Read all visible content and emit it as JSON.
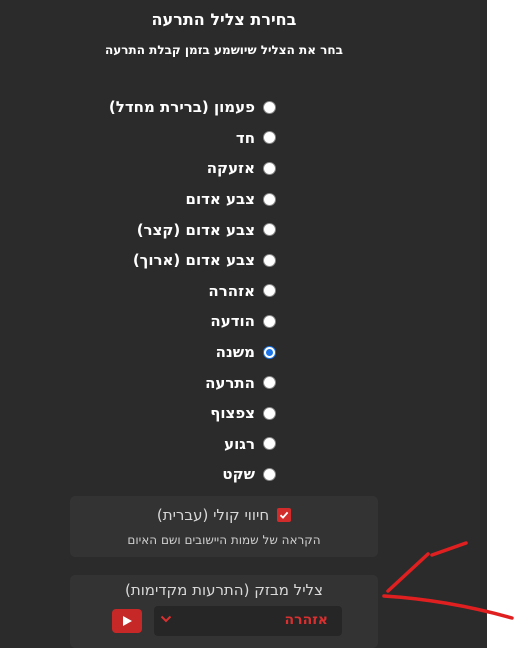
{
  "header": {
    "title": "בחירת צליל התרעה",
    "subtitle": "בחר את הצליל שיושמע בזמן קבלת התרעה"
  },
  "sound_options": [
    {
      "label": "פעמון (ברירת מחדל)",
      "selected": false
    },
    {
      "label": "חד",
      "selected": false
    },
    {
      "label": "אזעקה",
      "selected": false
    },
    {
      "label": "צבע אדום",
      "selected": false
    },
    {
      "label": "צבע אדום (קצר)",
      "selected": false
    },
    {
      "label": "צבע אדום (ארוך)",
      "selected": false
    },
    {
      "label": "אזהרה",
      "selected": false
    },
    {
      "label": "הודעה",
      "selected": false
    },
    {
      "label": "משנה",
      "selected": true
    },
    {
      "label": "התרעה",
      "selected": false
    },
    {
      "label": "צפצוף",
      "selected": false
    },
    {
      "label": "רגוע",
      "selected": false
    },
    {
      "label": "שקט",
      "selected": false
    }
  ],
  "voice": {
    "label": "חיווי קולי (עברית)",
    "checked": true,
    "description": "הקראה של שמות היישובים ושם האיום"
  },
  "early_siren": {
    "title": "צליל מבזק (התרעות מקדימות)",
    "selected_value": "אזהרה"
  },
  "colors": {
    "panel_bg": "#2b2b2b",
    "accent_red": "#d22b2b",
    "radio_blue": "#1a73e8",
    "annotation": "#e02020"
  }
}
